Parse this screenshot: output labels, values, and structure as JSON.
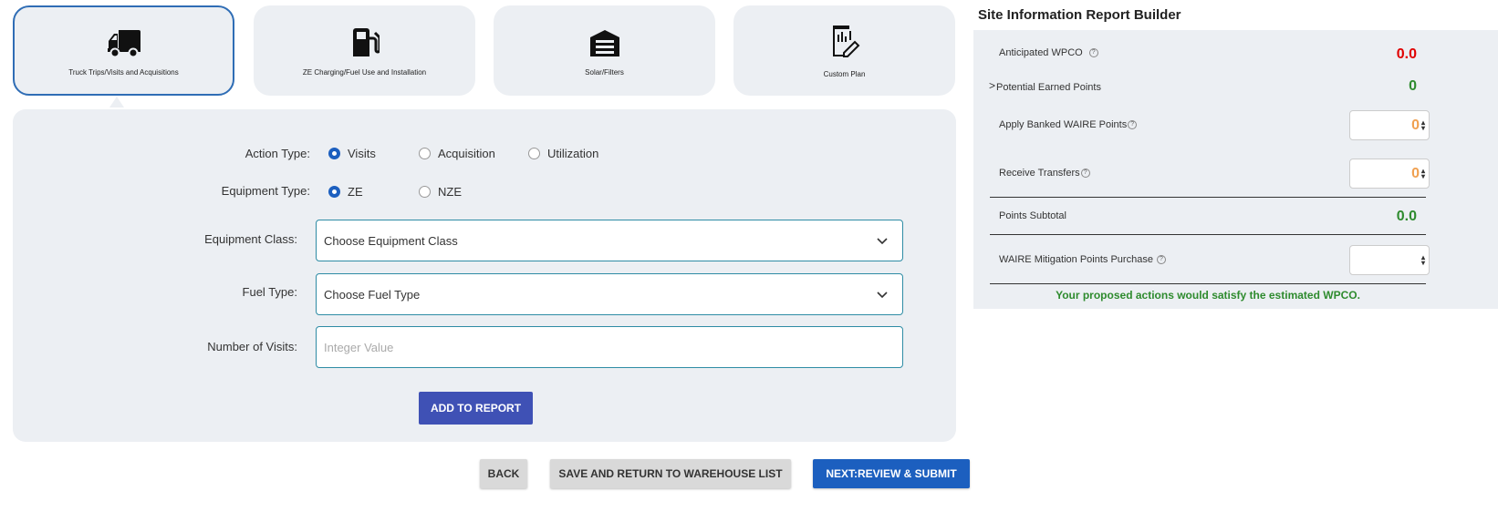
{
  "tabs": [
    {
      "label": "Truck Trips/Visits and Acquisitions",
      "icon": "truck-icon",
      "active": true
    },
    {
      "label": "ZE Charging/Fuel Use and Installation",
      "icon": "fuel-pump-icon",
      "active": false
    },
    {
      "label": "Solar/Filters",
      "icon": "warehouse-icon",
      "active": false
    },
    {
      "label": "Custom Plan",
      "icon": "custom-plan-icon",
      "active": false
    }
  ],
  "form": {
    "action_type_label": "Action Type:",
    "action_options": [
      "Visits",
      "Acquisition",
      "Utilization"
    ],
    "action_selected": "Visits",
    "equipment_type_label": "Equipment Type:",
    "equipment_options": [
      "ZE",
      "NZE"
    ],
    "equipment_selected": "ZE",
    "equipment_class_label": "Equipment Class:",
    "equipment_class_value": "Choose Equipment Class",
    "fuel_type_label": "Fuel Type:",
    "fuel_type_value": "Choose Fuel Type",
    "visits_label": "Number of Visits:",
    "visits_placeholder": "Integer Value",
    "add_button": "ADD TO REPORT"
  },
  "footer": {
    "back": "BACK",
    "save_return": "SAVE AND RETURN TO WAREHOUSE LIST",
    "next": "NEXT:REVIEW & SUBMIT"
  },
  "report": {
    "title": "Site Information Report Builder",
    "anticipated_label": "Anticipated WPCO",
    "anticipated_value": "0.0",
    "potential_label": "Potential Earned Points",
    "potential_value": "0",
    "banked_label": "Apply Banked WAIRE Points",
    "banked_value": "0",
    "transfers_label": "Receive Transfers",
    "transfers_value": "0",
    "subtotal_label": "Points Subtotal",
    "subtotal_value": "0.0",
    "mitigation_label": "WAIRE Mitigation Points Purchase",
    "mitigation_value": "",
    "message": "Your proposed actions would satisfy the estimated WPCO."
  },
  "colors": {
    "accent_blue": "#1c5fbf",
    "add_button": "#3f51b5",
    "red_value": "#e00000",
    "green_value": "#2e8b2e"
  }
}
